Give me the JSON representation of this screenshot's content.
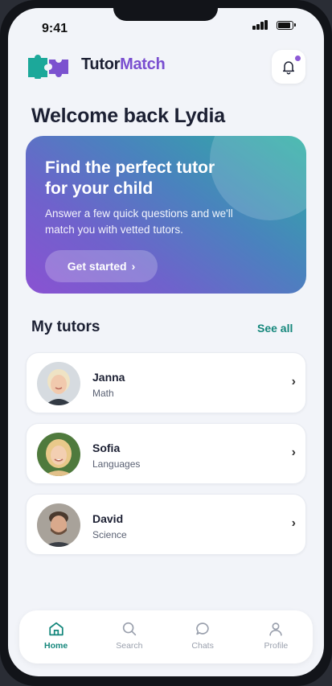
{
  "status_bar": {
    "time": "9:41"
  },
  "header": {
    "brand_part1": "Tutor",
    "brand_part2": "Match"
  },
  "welcome": "Welcome back Lydia",
  "hero": {
    "title": "Find the perfect tutor for your child",
    "subtitle": "Answer a few quick questions and we'll match you with vetted tutors.",
    "button_label": "Get started",
    "button_chevron": "›"
  },
  "tutors_section": {
    "title": "My tutors",
    "see_all": "See all",
    "tutors": [
      {
        "name": "Janna",
        "subject": "Math",
        "chevron": "›"
      },
      {
        "name": "Sofia",
        "subject": "Languages",
        "chevron": "›"
      },
      {
        "name": "David",
        "subject": "Science",
        "chevron": "›"
      }
    ]
  },
  "tabbar": {
    "tabs": [
      {
        "label": "Home",
        "icon": "home-icon",
        "active": true
      },
      {
        "label": "Search",
        "icon": "search-icon",
        "active": false
      },
      {
        "label": "Chats",
        "icon": "chat-icon",
        "active": false
      },
      {
        "label": "Profile",
        "icon": "profile-icon",
        "active": false
      }
    ]
  },
  "colors": {
    "brand_teal": "#15877c",
    "brand_purple": "#7a4fd0",
    "notification_dot": "#8d5ad6",
    "text_dark": "#1c2033"
  }
}
